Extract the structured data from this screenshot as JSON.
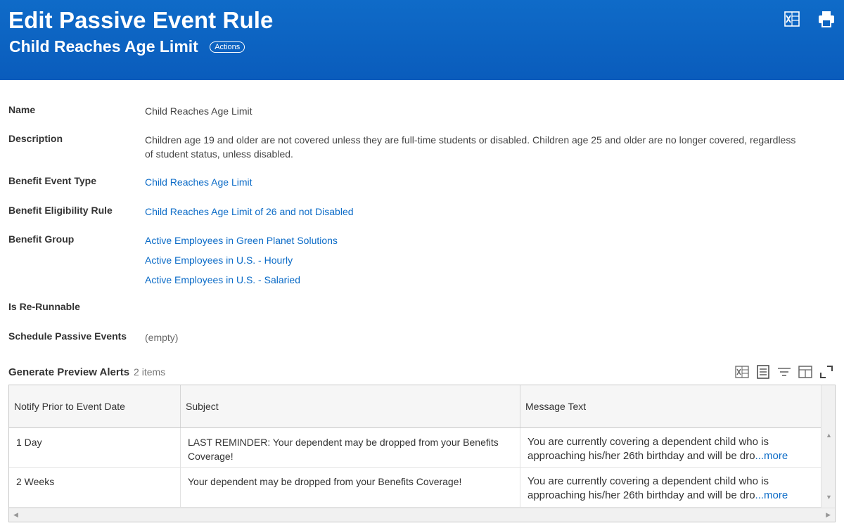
{
  "header": {
    "title": "Edit Passive Event Rule",
    "subtitle": "Child Reaches Age Limit",
    "actions_label": "Actions",
    "icons": [
      "excel-export-icon",
      "print-icon"
    ]
  },
  "fields": {
    "name": {
      "label": "Name",
      "value": "Child Reaches Age Limit"
    },
    "description": {
      "label": "Description",
      "value": "Children age 19 and older are not covered unless they are full-time students or disabled.  Children age 25 and older are no longer covered, regardless of student status, unless disabled."
    },
    "benefit_event_type": {
      "label": "Benefit Event Type",
      "value": "Child Reaches Age Limit"
    },
    "benefit_eligibility_rule": {
      "label": "Benefit Eligibility Rule",
      "value": "Child Reaches Age Limit of 26 and not Disabled"
    },
    "benefit_group": {
      "label": "Benefit Group",
      "values": [
        "Active Employees in Green Planet Solutions",
        "Active Employees in U.S. - Hourly",
        "Active Employees in U.S. - Salaried"
      ]
    },
    "is_rerunnable": {
      "label": "Is Re-Runnable",
      "value": ""
    },
    "schedule_passive_events": {
      "label": "Schedule Passive Events",
      "value": "(empty)"
    }
  },
  "grid": {
    "title": "Generate Preview Alerts",
    "count": "2 items",
    "columns": [
      "Notify Prior to Event Date",
      "Subject",
      "Message Text"
    ],
    "rows": [
      {
        "notify": "1 Day",
        "subject": "LAST REMINDER:  Your dependent may be dropped from your Benefits Coverage!",
        "message": "You are currently covering a dependent child who is approaching his/her 26th birthday and will be dro",
        "more": "...more"
      },
      {
        "notify": "2 Weeks",
        "subject": "Your dependent may be dropped from your Benefits Coverage!",
        "message": "You are currently covering a dependent child who is approaching his/her 26th birthday and will be dro",
        "more": "...more"
      }
    ],
    "tools": [
      "excel-export-icon",
      "view-table-icon",
      "filter-icon",
      "column-layout-icon",
      "fullscreen-icon"
    ]
  },
  "colors": {
    "header_bg": "#0a64c2",
    "link": "#0b6bc7"
  }
}
